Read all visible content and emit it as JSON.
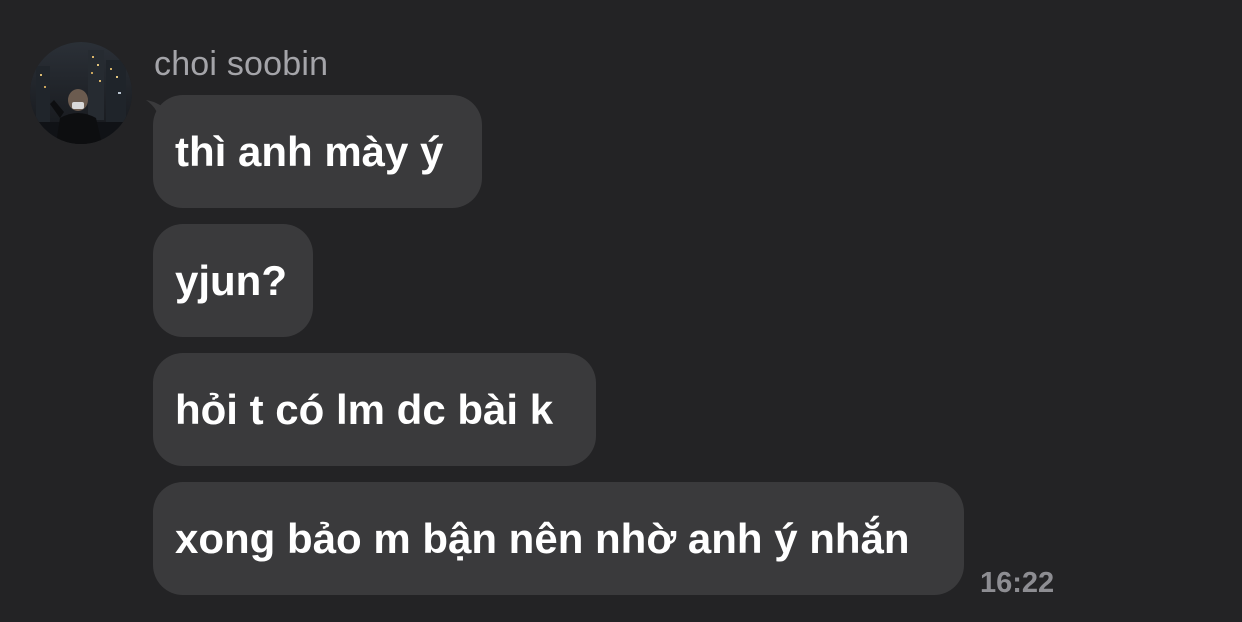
{
  "sender": {
    "name": "choi soobin"
  },
  "messages": [
    {
      "text": "thì anh mày ý"
    },
    {
      "text": "yjun?"
    },
    {
      "text": "hỏi t có lm dc bài k"
    },
    {
      "text": "xong bảo m bận nên nhờ anh ý nhắn"
    }
  ],
  "timestamp": "16:22",
  "colors": {
    "background": "#232325",
    "bubble": "#3a3a3c",
    "message_text": "#ffffff",
    "sender_name": "#a4a4a9",
    "timestamp": "#8d8d92"
  },
  "icons": {
    "avatar": "profile-photo"
  }
}
